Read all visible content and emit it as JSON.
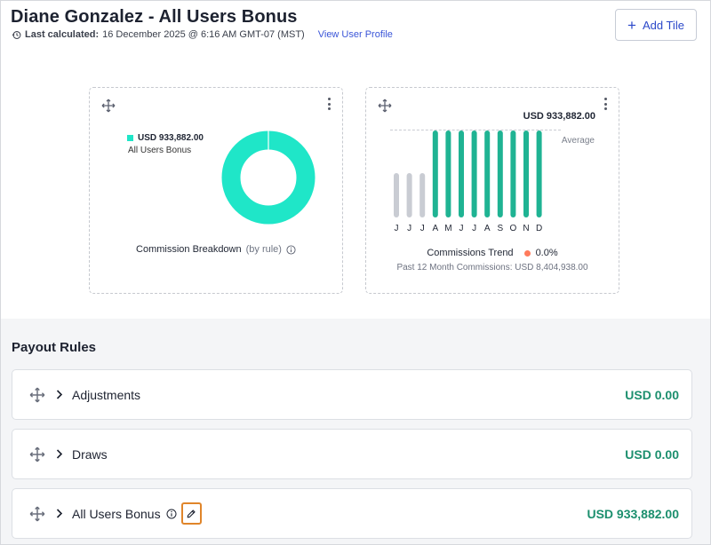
{
  "header": {
    "title": "Diane Gonzalez - All Users Bonus",
    "last_calculated_label": "Last calculated:",
    "last_calculated_value": "16 December 2025 @ 6:16 AM GMT-07 (MST)",
    "view_profile_link": "View User Profile",
    "add_tile_label": "Add Tile"
  },
  "tiles": {
    "breakdown": {
      "legend_value": "USD 933,882.00",
      "legend_name": "All Users Bonus",
      "caption": "Commission Breakdown",
      "caption_suffix": "(by rule)",
      "segment_color": "#1fe6c8"
    },
    "trend": {
      "value": "USD 933,882.00",
      "average_label": "Average",
      "caption": "Commissions Trend",
      "change": "0.0%",
      "subtitle": "Past 12 Month Commissions: USD 8,404,938.00"
    }
  },
  "chart_data": {
    "type": "bar",
    "categories": [
      "J",
      "J",
      "J",
      "A",
      "M",
      "J",
      "J",
      "A",
      "S",
      "O",
      "N",
      "D"
    ],
    "series": [
      {
        "values": [
          0,
          0,
          0,
          933882,
          933882,
          933882,
          933882,
          933882,
          933882,
          933882,
          933882,
          933882
        ]
      }
    ],
    "colors": {
      "active": "#1fb393",
      "empty": "#c9ccd3"
    },
    "ylim": [
      0,
      933882
    ]
  },
  "payout_rules": {
    "title": "Payout Rules",
    "rows": [
      {
        "name": "Adjustments",
        "amount": "USD 0.00"
      },
      {
        "name": "Draws",
        "amount": "USD 0.00"
      },
      {
        "name": "All Users Bonus",
        "amount": "USD 933,882.00"
      }
    ]
  }
}
